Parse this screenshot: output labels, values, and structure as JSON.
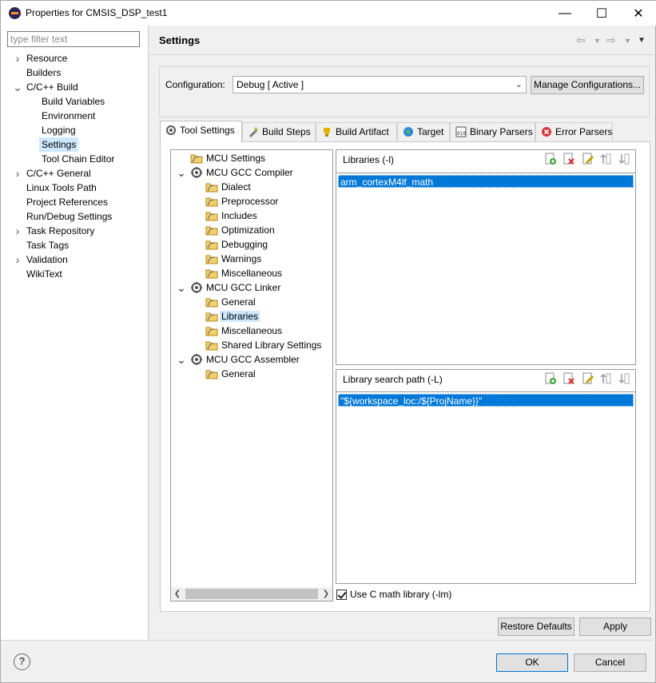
{
  "window": {
    "title": "Properties for CMSIS_DSP_test1",
    "minimize": "—",
    "maximize": "☐",
    "close": "✕"
  },
  "sidebar": {
    "filter_placeholder": "type filter text",
    "items": [
      {
        "label": "Resource",
        "twisty": ">"
      },
      {
        "label": "Builders",
        "twisty": ""
      },
      {
        "label": "C/C++ Build",
        "twisty": "v"
      },
      {
        "label": "Build Variables",
        "twisty": ""
      },
      {
        "label": "Environment",
        "twisty": ""
      },
      {
        "label": "Logging",
        "twisty": ""
      },
      {
        "label": "Settings",
        "twisty": "",
        "selected": true
      },
      {
        "label": "Tool Chain Editor",
        "twisty": ""
      },
      {
        "label": "C/C++ General",
        "twisty": ">"
      },
      {
        "label": "Linux Tools Path",
        "twisty": ""
      },
      {
        "label": "Project References",
        "twisty": ""
      },
      {
        "label": "Run/Debug Settings",
        "twisty": ""
      },
      {
        "label": "Task Repository",
        "twisty": ">"
      },
      {
        "label": "Task Tags",
        "twisty": ""
      },
      {
        "label": "Validation",
        "twisty": ">"
      },
      {
        "label": "WikiText",
        "twisty": ""
      }
    ]
  },
  "header": {
    "title": "Settings"
  },
  "configuration": {
    "label": "Configuration:",
    "value": "Debug  [ Active ]",
    "manage_button": "Manage Configurations..."
  },
  "tabs": [
    {
      "label": "Tool Settings",
      "icon": "tool-settings-icon",
      "active": true
    },
    {
      "label": "Build Steps",
      "icon": "build-steps-icon"
    },
    {
      "label": "Build Artifact",
      "icon": "trophy-icon"
    },
    {
      "label": "Target",
      "icon": "globe-icon"
    },
    {
      "label": "Binary Parsers",
      "icon": "binary-icon"
    },
    {
      "label": "Error Parsers",
      "icon": "error-icon"
    }
  ],
  "tool_tree": [
    {
      "label": "MCU Settings",
      "level": 0,
      "kind": "folder"
    },
    {
      "label": "MCU GCC Compiler",
      "level": 0,
      "kind": "gear",
      "twisty": "v"
    },
    {
      "label": "Dialect",
      "level": 1,
      "kind": "folder"
    },
    {
      "label": "Preprocessor",
      "level": 1,
      "kind": "folder"
    },
    {
      "label": "Includes",
      "level": 1,
      "kind": "folder"
    },
    {
      "label": "Optimization",
      "level": 1,
      "kind": "folder"
    },
    {
      "label": "Debugging",
      "level": 1,
      "kind": "folder"
    },
    {
      "label": "Warnings",
      "level": 1,
      "kind": "folder"
    },
    {
      "label": "Miscellaneous",
      "level": 1,
      "kind": "folder"
    },
    {
      "label": "MCU GCC Linker",
      "level": 0,
      "kind": "gear",
      "twisty": "v"
    },
    {
      "label": "General",
      "level": 1,
      "kind": "folder"
    },
    {
      "label": "Libraries",
      "level": 1,
      "kind": "folder",
      "selected": true
    },
    {
      "label": "Miscellaneous",
      "level": 1,
      "kind": "folder"
    },
    {
      "label": "Shared Library Settings",
      "level": 1,
      "kind": "folder"
    },
    {
      "label": "MCU GCC Assembler",
      "level": 0,
      "kind": "gear",
      "twisty": "v"
    },
    {
      "label": "General",
      "level": 1,
      "kind": "folder"
    }
  ],
  "libraries": {
    "header": "Libraries (-l)",
    "items": [
      "arm_cortexM4lf_math"
    ]
  },
  "search_path": {
    "header": "Library search path (-L)",
    "items": [
      "\"${workspace_loc:/${ProjName}}\""
    ]
  },
  "checkbox": {
    "label": "Use C math library (-lm)",
    "checked": true
  },
  "buttons": {
    "restore": "Restore Defaults",
    "apply": "Apply",
    "ok": "OK",
    "cancel": "Cancel"
  },
  "help": "?"
}
